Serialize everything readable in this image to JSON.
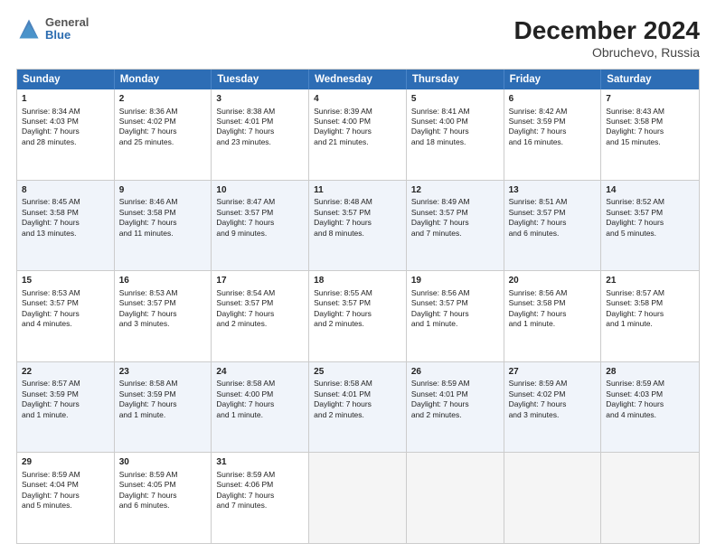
{
  "header": {
    "logo_line1": "General",
    "logo_line2": "Blue",
    "title": "December 2024",
    "subtitle": "Obruchevo, Russia"
  },
  "days_of_week": [
    "Sunday",
    "Monday",
    "Tuesday",
    "Wednesday",
    "Thursday",
    "Friday",
    "Saturday"
  ],
  "weeks": [
    [
      {
        "day": "1",
        "lines": [
          "Sunrise: 8:34 AM",
          "Sunset: 4:03 PM",
          "Daylight: 7 hours",
          "and 28 minutes."
        ]
      },
      {
        "day": "2",
        "lines": [
          "Sunrise: 8:36 AM",
          "Sunset: 4:02 PM",
          "Daylight: 7 hours",
          "and 25 minutes."
        ]
      },
      {
        "day": "3",
        "lines": [
          "Sunrise: 8:38 AM",
          "Sunset: 4:01 PM",
          "Daylight: 7 hours",
          "and 23 minutes."
        ]
      },
      {
        "day": "4",
        "lines": [
          "Sunrise: 8:39 AM",
          "Sunset: 4:00 PM",
          "Daylight: 7 hours",
          "and 21 minutes."
        ]
      },
      {
        "day": "5",
        "lines": [
          "Sunrise: 8:41 AM",
          "Sunset: 4:00 PM",
          "Daylight: 7 hours",
          "and 18 minutes."
        ]
      },
      {
        "day": "6",
        "lines": [
          "Sunrise: 8:42 AM",
          "Sunset: 3:59 PM",
          "Daylight: 7 hours",
          "and 16 minutes."
        ]
      },
      {
        "day": "7",
        "lines": [
          "Sunrise: 8:43 AM",
          "Sunset: 3:58 PM",
          "Daylight: 7 hours",
          "and 15 minutes."
        ]
      }
    ],
    [
      {
        "day": "8",
        "lines": [
          "Sunrise: 8:45 AM",
          "Sunset: 3:58 PM",
          "Daylight: 7 hours",
          "and 13 minutes."
        ]
      },
      {
        "day": "9",
        "lines": [
          "Sunrise: 8:46 AM",
          "Sunset: 3:58 PM",
          "Daylight: 7 hours",
          "and 11 minutes."
        ]
      },
      {
        "day": "10",
        "lines": [
          "Sunrise: 8:47 AM",
          "Sunset: 3:57 PM",
          "Daylight: 7 hours",
          "and 9 minutes."
        ]
      },
      {
        "day": "11",
        "lines": [
          "Sunrise: 8:48 AM",
          "Sunset: 3:57 PM",
          "Daylight: 7 hours",
          "and 8 minutes."
        ]
      },
      {
        "day": "12",
        "lines": [
          "Sunrise: 8:49 AM",
          "Sunset: 3:57 PM",
          "Daylight: 7 hours",
          "and 7 minutes."
        ]
      },
      {
        "day": "13",
        "lines": [
          "Sunrise: 8:51 AM",
          "Sunset: 3:57 PM",
          "Daylight: 7 hours",
          "and 6 minutes."
        ]
      },
      {
        "day": "14",
        "lines": [
          "Sunrise: 8:52 AM",
          "Sunset: 3:57 PM",
          "Daylight: 7 hours",
          "and 5 minutes."
        ]
      }
    ],
    [
      {
        "day": "15",
        "lines": [
          "Sunrise: 8:53 AM",
          "Sunset: 3:57 PM",
          "Daylight: 7 hours",
          "and 4 minutes."
        ]
      },
      {
        "day": "16",
        "lines": [
          "Sunrise: 8:53 AM",
          "Sunset: 3:57 PM",
          "Daylight: 7 hours",
          "and 3 minutes."
        ]
      },
      {
        "day": "17",
        "lines": [
          "Sunrise: 8:54 AM",
          "Sunset: 3:57 PM",
          "Daylight: 7 hours",
          "and 2 minutes."
        ]
      },
      {
        "day": "18",
        "lines": [
          "Sunrise: 8:55 AM",
          "Sunset: 3:57 PM",
          "Daylight: 7 hours",
          "and 2 minutes."
        ]
      },
      {
        "day": "19",
        "lines": [
          "Sunrise: 8:56 AM",
          "Sunset: 3:57 PM",
          "Daylight: 7 hours",
          "and 1 minute."
        ]
      },
      {
        "day": "20",
        "lines": [
          "Sunrise: 8:56 AM",
          "Sunset: 3:58 PM",
          "Daylight: 7 hours",
          "and 1 minute."
        ]
      },
      {
        "day": "21",
        "lines": [
          "Sunrise: 8:57 AM",
          "Sunset: 3:58 PM",
          "Daylight: 7 hours",
          "and 1 minute."
        ]
      }
    ],
    [
      {
        "day": "22",
        "lines": [
          "Sunrise: 8:57 AM",
          "Sunset: 3:59 PM",
          "Daylight: 7 hours",
          "and 1 minute."
        ]
      },
      {
        "day": "23",
        "lines": [
          "Sunrise: 8:58 AM",
          "Sunset: 3:59 PM",
          "Daylight: 7 hours",
          "and 1 minute."
        ]
      },
      {
        "day": "24",
        "lines": [
          "Sunrise: 8:58 AM",
          "Sunset: 4:00 PM",
          "Daylight: 7 hours",
          "and 1 minute."
        ]
      },
      {
        "day": "25",
        "lines": [
          "Sunrise: 8:58 AM",
          "Sunset: 4:01 PM",
          "Daylight: 7 hours",
          "and 2 minutes."
        ]
      },
      {
        "day": "26",
        "lines": [
          "Sunrise: 8:59 AM",
          "Sunset: 4:01 PM",
          "Daylight: 7 hours",
          "and 2 minutes."
        ]
      },
      {
        "day": "27",
        "lines": [
          "Sunrise: 8:59 AM",
          "Sunset: 4:02 PM",
          "Daylight: 7 hours",
          "and 3 minutes."
        ]
      },
      {
        "day": "28",
        "lines": [
          "Sunrise: 8:59 AM",
          "Sunset: 4:03 PM",
          "Daylight: 7 hours",
          "and 4 minutes."
        ]
      }
    ],
    [
      {
        "day": "29",
        "lines": [
          "Sunrise: 8:59 AM",
          "Sunset: 4:04 PM",
          "Daylight: 7 hours",
          "and 5 minutes."
        ]
      },
      {
        "day": "30",
        "lines": [
          "Sunrise: 8:59 AM",
          "Sunset: 4:05 PM",
          "Daylight: 7 hours",
          "and 6 minutes."
        ]
      },
      {
        "day": "31",
        "lines": [
          "Sunrise: 8:59 AM",
          "Sunset: 4:06 PM",
          "Daylight: 7 hours",
          "and 7 minutes."
        ]
      },
      {
        "day": "",
        "lines": []
      },
      {
        "day": "",
        "lines": []
      },
      {
        "day": "",
        "lines": []
      },
      {
        "day": "",
        "lines": []
      }
    ]
  ]
}
